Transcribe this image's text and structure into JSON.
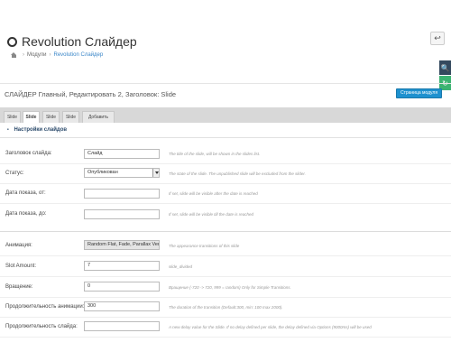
{
  "header": {
    "title": "Revolution Слайдер",
    "back_icon": "reply-icon"
  },
  "breadcrumb": {
    "home_icon": "home-icon",
    "items": [
      "Модули",
      "Revolution Слайдер"
    ]
  },
  "side_tabs": {
    "help_icon": "search-icon",
    "refresh_icon": "refresh-icon",
    "help_glyph": "🔍",
    "refresh_glyph": "↻"
  },
  "panel": {
    "title": "СЛАЙДЕР Главный, Редактировать 2, Заголовок: Slide",
    "module_button": "Страница модуля"
  },
  "tabs": [
    {
      "label": "Slide",
      "active": false
    },
    {
      "label": "Slide",
      "active": true
    },
    {
      "label": "Slide",
      "active": false
    },
    {
      "label": "Slide",
      "active": false
    },
    {
      "label": "Добавить",
      "active": false
    }
  ],
  "section": {
    "bullet": "•",
    "title": "Настройки слайдов"
  },
  "form": {
    "slide_title": {
      "label": "Заголовок слайда:",
      "value": "Слайд",
      "hint": "The title of the slide, will be shown in the slides list."
    },
    "status": {
      "label": "Статус:",
      "value": "Опубликован",
      "hint": "The state of the slide. The unpublished slide will be excluded from the slider."
    },
    "date_from": {
      "label": "Дата показа, от:",
      "value": "",
      "hint": "If set, slide will be visible after the date is reached"
    },
    "date_to": {
      "label": "Дата показа, до:",
      "value": "",
      "hint": "If set, slide will be visible till the date is reached"
    },
    "animation": {
      "label": "Анимация:",
      "value": "Random Flat, Fade, Parallax Vertical",
      "hint": "The appearance transitions of this slide"
    },
    "slot_amount": {
      "label": "Slot Amount:",
      "value": "7",
      "hint": "slide_divided"
    },
    "rotation": {
      "label": "Вращение:",
      "value": "0",
      "hint": "Вращение (-720 -> 720, 999 = random) Only for Simple Transitions."
    },
    "anim_duration": {
      "label": "Продолжительность анимации:",
      "value": "300",
      "hint": "The duration of the transition (Default:300, min: 100 max 2000)."
    },
    "slide_duration": {
      "label": "Продолжительность слайда:",
      "value": "",
      "hint": "A new delay value for the Slide. If no delay defined per slide, the delay defined via Options (9000ms) will be used"
    }
  }
}
